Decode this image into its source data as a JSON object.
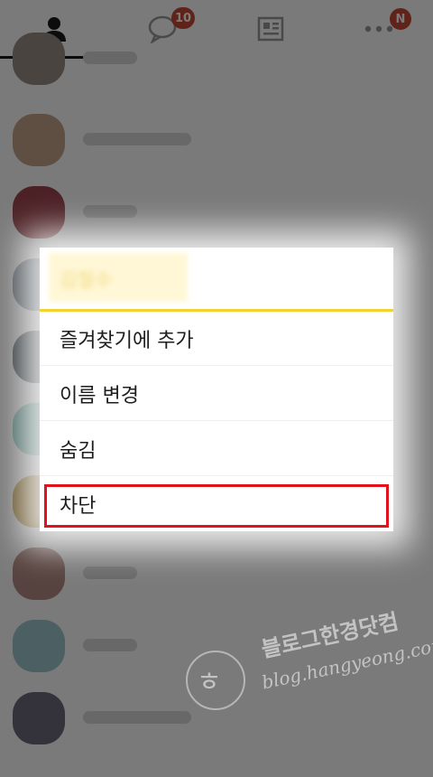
{
  "tabs": {
    "chat_badge": "10",
    "more_badge": "N"
  },
  "dialog": {
    "title": "김철수",
    "menu": [
      {
        "label": "즐겨찾기에 추가"
      },
      {
        "label": "이름 변경"
      },
      {
        "label": "숨김"
      },
      {
        "label": "차단"
      }
    ]
  },
  "watermark": {
    "name": "블로그한경닷컴",
    "url": "blog.hangyeong.com"
  },
  "colors": {
    "accent_yellow": "#f2d331",
    "badge_red": "#c94a36",
    "highlight_red": "#e0121b"
  }
}
